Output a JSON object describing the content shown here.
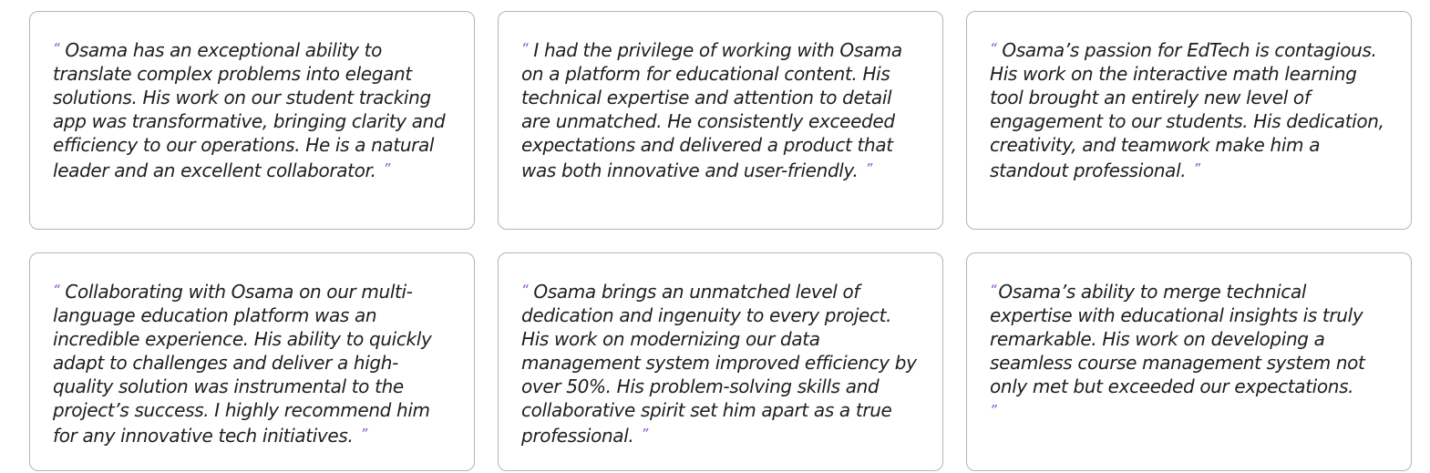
{
  "accent_color": "#8a4bd0",
  "quote_marks": {
    "open": "“",
    "close": "”"
  },
  "testimonials": [
    {
      "text": "Osama has an exceptional ability to translate complex problems into elegant solutions. His work on our student tracking app was transformative, bringing clarity and efficiency to our operations. He is a natural leader and an excellent collaborator."
    },
    {
      "text": "I had the privilege of working with Osama on a platform for educational content. His technical expertise and attention to detail are unmatched. He consistently exceeded expectations and delivered a product that was both innovative and user-friendly."
    },
    {
      "text": "Osama’s passion for EdTech is contagious. His work on the interactive math learning tool brought an entirely new level of engagement to our students. His dedication, creativity, and teamwork make him a standout professional."
    },
    {
      "text": "Collaborating with Osama on our multi-language education platform was an incredible experience. His ability to quickly adapt to challenges and deliver a high-quality solution was instrumental to the project’s success. I highly recommend him for any innovative tech initiatives."
    },
    {
      "text": "Osama brings an unmatched level of dedication and ingenuity to every project. His work on modernizing our data management system improved efficiency by over 50%. His problem-solving skills and collaborative spirit set him apart as a true professional."
    },
    {
      "text": "Osama’s ability to merge technical expertise with educational insights is truly remarkable. His work on developing a seamless course management system not only met but exceeded our expectations."
    }
  ]
}
